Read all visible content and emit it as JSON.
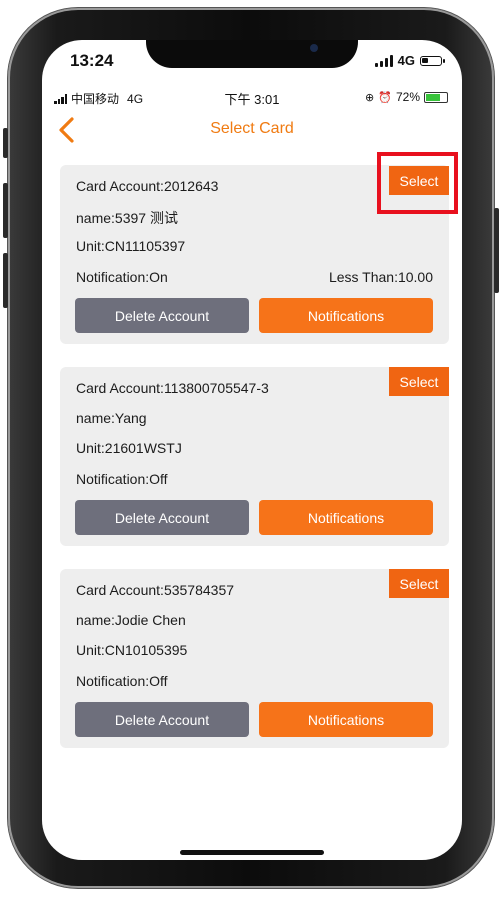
{
  "ios_status": {
    "time": "13:24",
    "network": "4G"
  },
  "app_status": {
    "carrier": "中国移动",
    "network": "4G",
    "time": "下午 3:01",
    "battery": "72%"
  },
  "nav": {
    "title": "Select Card",
    "back_icon": "chevron-left-icon"
  },
  "cards": [
    {
      "account": "Card Account:2012643",
      "name": "name:5397 测试",
      "unit": "Unit:CN11105397",
      "notification": "Notification:On",
      "less_than": "Less Than:10.00",
      "select_label": "Select",
      "delete_label": "Delete Account",
      "notif_label": "Notifications"
    },
    {
      "account": "Card Account:113800705547-3",
      "name": "name:Yang",
      "unit": "Unit:21601WSTJ",
      "notification": "Notification:Off",
      "select_label": "Select",
      "delete_label": "Delete Account",
      "notif_label": "Notifications"
    },
    {
      "account": "Card Account:535784357",
      "name": "name:Jodie Chen",
      "unit": "Unit:CN10105395",
      "notification": "Notification:Off",
      "select_label": "Select",
      "delete_label": "Delete Account",
      "notif_label": "Notifications"
    }
  ],
  "colors": {
    "accent": "#f07b12",
    "select_button": "#f06512",
    "delete_button": "#6e6f7c",
    "highlight": "#e8101e",
    "card_background": "#eeeeee"
  }
}
